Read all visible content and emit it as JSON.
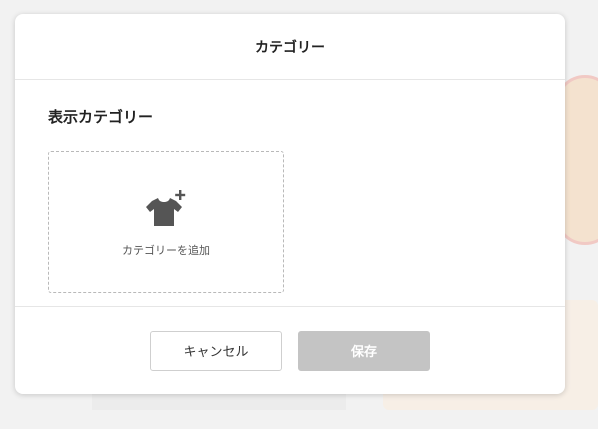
{
  "modal": {
    "title": "カテゴリー",
    "section_title": "表示カテゴリー",
    "add_category_label": "カテゴリーを追加",
    "cancel_label": "キャンセル",
    "save_label": "保存"
  },
  "icons": {
    "add_category": "shirt-plus-icon"
  },
  "colors": {
    "save_disabled": "#c4c4c4",
    "icon": "#555555"
  }
}
